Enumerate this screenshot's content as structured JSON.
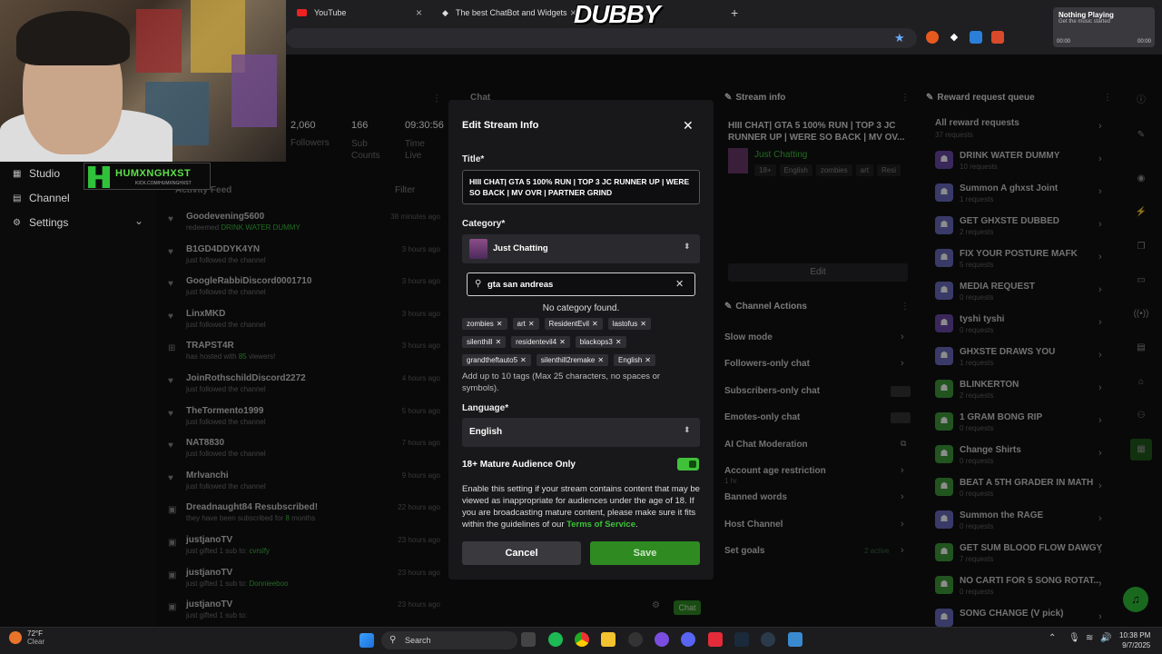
{
  "browser": {
    "tabs": [
      {
        "label": "YouTube"
      },
      {
        "label": "The best ChatBot and Widgets"
      }
    ],
    "overlay_brand": "DUBBY",
    "now_playing": {
      "title": "Nothing Playing",
      "subtitle": "Get the music started",
      "time_start": "00:00",
      "time_end": "00:00"
    }
  },
  "webcam": {
    "badge_title": "HUMXNGHXST",
    "badge_sub": "KICK.COM/HUMXNGHXST"
  },
  "sidebar": {
    "items": [
      {
        "label": "Studio"
      },
      {
        "label": "Channel"
      },
      {
        "label": "Settings"
      }
    ]
  },
  "stats": {
    "followers_value": "2,060",
    "followers_label": "Followers",
    "subs_value": "166",
    "subs_label": "Sub\nCounts",
    "time_value": "09:30:56",
    "time_label": "Time\nLive"
  },
  "activity": {
    "title": "Activity Feed",
    "filter": "Filter",
    "items": [
      {
        "name": "Goodevening5600",
        "desc": "redeemed ",
        "hl": "DRINK WATER DUMMY",
        "time": "38 minutes ago"
      },
      {
        "name": "B1GD4DDYK4YN",
        "desc": "just followed the channel",
        "hl": "",
        "time": "3 hours ago"
      },
      {
        "name": "GoogleRabbiDiscord0001710",
        "desc": "just followed the channel",
        "hl": "",
        "time": "3 hours ago"
      },
      {
        "name": "LinxMKD",
        "desc": "just followed the channel",
        "hl": "",
        "time": "3 hours ago"
      },
      {
        "name": "TRAPST4R",
        "desc": "has hosted with ",
        "hl": "85",
        "desc2": " viewers!",
        "time": "3 hours ago"
      },
      {
        "name": "JoinRothschildDiscord2272",
        "desc": "just followed the channel",
        "hl": "",
        "time": "4 hours ago"
      },
      {
        "name": "TheTormento1999",
        "desc": "just followed the channel",
        "hl": "",
        "time": "5 hours ago"
      },
      {
        "name": "NAT8830",
        "desc": "just followed the channel",
        "hl": "",
        "time": "7 hours ago"
      },
      {
        "name": "Mrlvanchi",
        "desc": "just followed the channel",
        "hl": "",
        "time": "9 hours ago"
      },
      {
        "name": "Dreadnaught84 Resubscribed!",
        "desc": "they have been subscribed for ",
        "hl": "8",
        "desc2": " months",
        "time": "22 hours ago"
      },
      {
        "name": "justjanoTV",
        "desc": "just gifted 1 sub to: ",
        "hl": "cvrslfy",
        "time": "23 hours ago"
      },
      {
        "name": "justjanoTV",
        "desc": "just gifted 1 sub to: ",
        "hl": "Donnieeboo",
        "time": "23 hours ago"
      },
      {
        "name": "justjanoTV",
        "desc": "just gifted 1 sub to: ",
        "hl": "",
        "time": "23 hours ago"
      }
    ]
  },
  "chat": {
    "title": "Chat",
    "send": "Chat"
  },
  "stream_info": {
    "title": "Stream info",
    "stream_title": "HIII CHAT| GTA 5 100% RUN | TOP 3 JC RUNNER UP | WERE SO BACK | MV OV...",
    "category": "Just Chatting",
    "tags": [
      "18+",
      "English",
      "zombies",
      "art",
      "Resi"
    ],
    "edit": "Edit"
  },
  "channel_actions": {
    "title": "Channel Actions",
    "items": [
      {
        "label": "Slow mode",
        "type": "chev"
      },
      {
        "label": "Followers-only chat",
        "type": "chev"
      },
      {
        "label": "Subscribers-only chat",
        "type": "toggle"
      },
      {
        "label": "Emotes-only chat",
        "type": "toggle"
      },
      {
        "label": "AI Chat Moderation",
        "type": "ext"
      },
      {
        "label": "Account age restriction",
        "sub": "1 hr",
        "type": "chev"
      },
      {
        "label": "Banned words",
        "type": "chev"
      },
      {
        "label": "Host Channel",
        "type": "chev"
      },
      {
        "label": "Set goals",
        "sub_right": "2 active",
        "type": "chev"
      }
    ]
  },
  "reward_queue": {
    "title": "Reward request queue",
    "all_label": "All reward requests",
    "all_count": "37 requests",
    "items": [
      {
        "name": "DRINK WATER DUMMY",
        "count": "10 requests",
        "color": "pk"
      },
      {
        "name": "Summon A ghxst Joint",
        "count": "1 requests",
        "color": ""
      },
      {
        "name": "GET GHXSTE DUBBED",
        "count": "2 requests",
        "color": ""
      },
      {
        "name": "FIX YOUR POSTURE MAFK",
        "count": "5 requests",
        "color": ""
      },
      {
        "name": "MEDIA REQUEST",
        "count": "0 requests",
        "color": ""
      },
      {
        "name": "tyshi tyshi",
        "count": "0 requests",
        "color": "pk"
      },
      {
        "name": "GHXSTE DRAWS YOU",
        "count": "1 requests",
        "color": ""
      },
      {
        "name": "BLINKERTON",
        "count": "2 requests",
        "color": "g"
      },
      {
        "name": "1 GRAM BONG RIP",
        "count": "0 requests",
        "color": "g"
      },
      {
        "name": "Change Shirts",
        "count": "0 requests",
        "color": "g"
      },
      {
        "name": "BEAT A 5TH GRADER IN MATH",
        "count": "0 requests",
        "color": "g"
      },
      {
        "name": "Summon the RAGE",
        "count": "0 requests",
        "color": ""
      },
      {
        "name": "GET SUM BLOOD FLOW DAWGY",
        "count": "7 requests",
        "color": "g"
      },
      {
        "name": "NO CARTI FOR 5 SONG ROTAT...",
        "count": "0 requests",
        "color": "g"
      },
      {
        "name": "SONG CHANGE (V pick)",
        "count": "",
        "color": ""
      }
    ]
  },
  "modal": {
    "heading": "Edit Stream Info",
    "title_label": "Title*",
    "title_value": "HIII CHAT| GTA 5 100% RUN | TOP 3 JC RUNNER UP | WERE SO BACK | MV OVR | PARTNER GRIND",
    "category_label": "Category*",
    "category_value": "Just Chatting",
    "search_value": "gta san andreas",
    "no_category": "No category found.",
    "tags_row1": [
      "zombies",
      "art",
      "ResidentEvil",
      "lastofus"
    ],
    "tags_row2": [
      "silenthill",
      "residentevil4",
      "blackops3"
    ],
    "tags_row3": [
      "grandtheftauto5",
      "silenthill2remake",
      "English"
    ],
    "tags_note": "Add up to 10 tags (Max 25 characters, no spaces or symbols).",
    "language_label": "Language*",
    "language_value": "English",
    "mature_label": "18+ Mature Audience Only",
    "mature_on": true,
    "mature_desc": "Enable this setting if your stream contains content that may be viewed as inappropriate for audiences under the age of 18. If you are broadcasting mature content, please make sure it fits within the guidelines of our ",
    "mature_link": "Terms of Service",
    "mature_end": ".",
    "cancel": "Cancel",
    "save": "Save"
  },
  "taskbar": {
    "temp": "72°F",
    "weather": "Clear",
    "search": "Search",
    "time": "10:38 PM",
    "date": "9/7/2025"
  }
}
